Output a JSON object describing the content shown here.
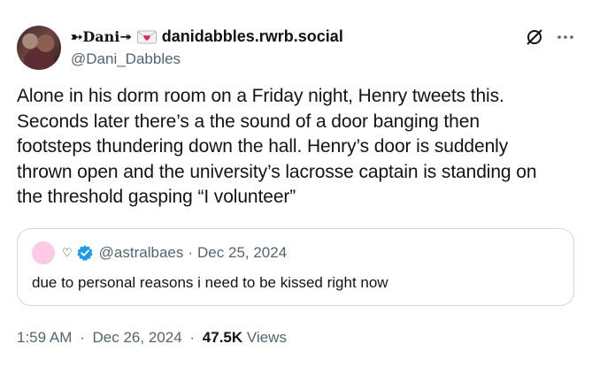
{
  "author": {
    "display_name": "➳Dani↠",
    "domain_name": "danidabbles.rwrb.social",
    "handle": "@Dani_Dabbles"
  },
  "tweet": {
    "lines": [
      "Alone in his dorm room on a Friday night, Henry tweets this.",
      "Seconds later there’s a the sound of a door banging then",
      "footsteps thundering down the hall. Henry’s door is suddenly",
      "thrown open and the university’s lacrosse captain is standing on",
      "the threshold gasping “I volunteer”"
    ]
  },
  "quote": {
    "heart": "♡",
    "handle": "@astralbaes",
    "separator": "·",
    "date": "Dec 25, 2024",
    "text": "due to personal reasons i need to be kissed right now"
  },
  "meta": {
    "time": "1:59 AM",
    "sep1": "·",
    "date": "Dec 26, 2024",
    "sep2": "·",
    "views_count": "47.5K",
    "views_label": "Views"
  },
  "icons": {
    "envelope": "love-letter-icon",
    "grok": "grok-icon",
    "more": "more-icon",
    "verified": "verified-badge-icon"
  },
  "colors": {
    "text": "#0f1419",
    "secondary": "#536471",
    "border": "#cfd9de",
    "verified": "#1d9bf0",
    "quote_avatar": "#ffc8e4"
  }
}
